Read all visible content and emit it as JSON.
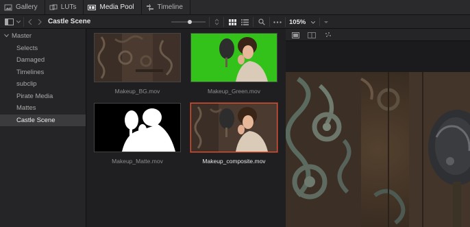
{
  "page_tabs": [
    {
      "label": "Gallery",
      "icon": "gallery-icon",
      "active": false
    },
    {
      "label": "LUTs",
      "icon": "luts-icon",
      "active": false
    },
    {
      "label": "Media Pool",
      "icon": "media-pool-icon",
      "active": true
    },
    {
      "label": "Timeline",
      "icon": "timeline-icon",
      "active": false
    }
  ],
  "toolbar": {
    "bin_title": "Castle Scene",
    "zoom": "105%"
  },
  "sidebar": {
    "root": "Master",
    "items": [
      {
        "label": "Selects"
      },
      {
        "label": "Damaged"
      },
      {
        "label": "Timelines"
      },
      {
        "label": "subclip"
      },
      {
        "label": "Pirate Media"
      },
      {
        "label": "Mattes"
      },
      {
        "label": "Castle Scene",
        "selected": true
      }
    ]
  },
  "clips": [
    {
      "name": "Makeup_BG.mov",
      "kind": "background",
      "selected": false
    },
    {
      "name": "Makeup_Green.mov",
      "kind": "green",
      "selected": false
    },
    {
      "name": "Makeup_Matte.mov",
      "kind": "matte",
      "selected": false
    },
    {
      "name": "Makeup_composite.mov",
      "kind": "composite",
      "selected": true
    }
  ],
  "colors": {
    "accent_selected": "#d8573a",
    "green_screen": "#33c219",
    "ui_bg": "#1f1f21"
  }
}
